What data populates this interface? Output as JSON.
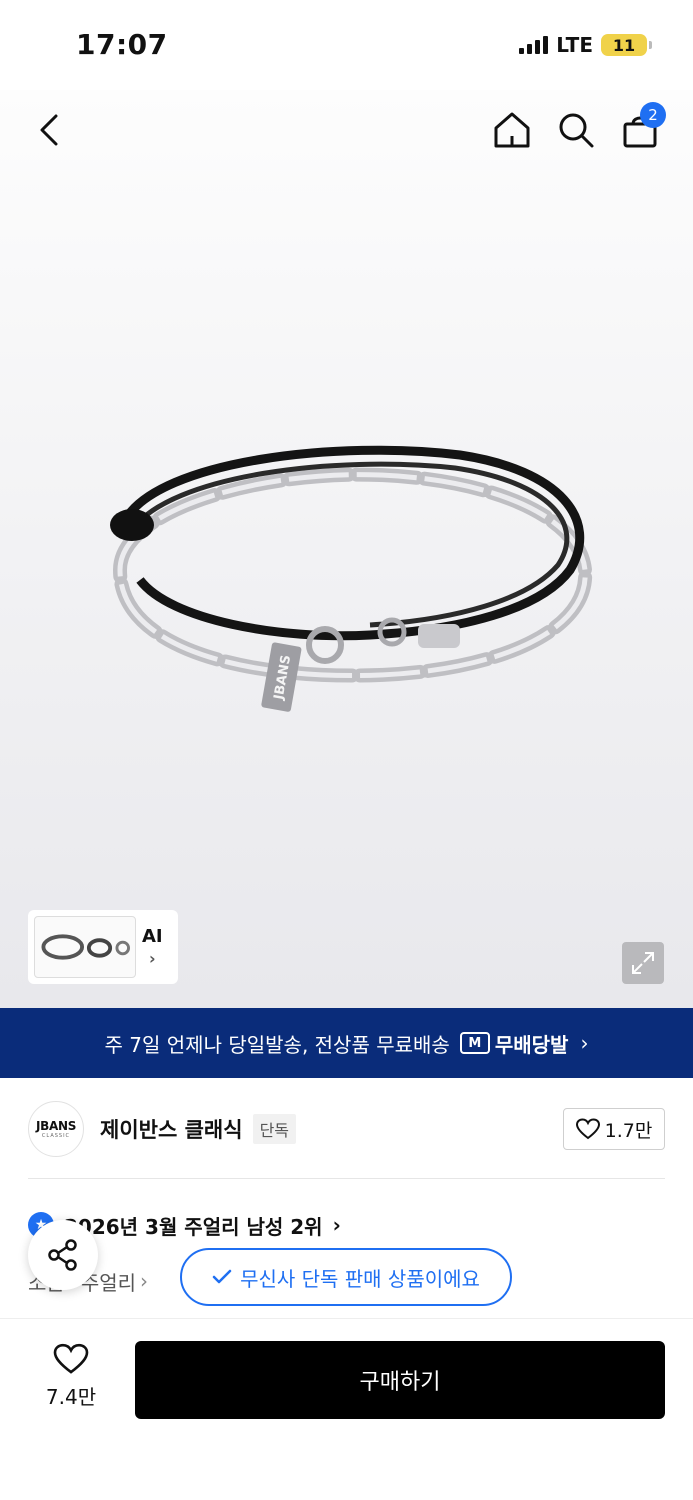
{
  "status_bar": {
    "time": "17:07",
    "network": "LTE",
    "battery": "11"
  },
  "nav": {
    "cart_count": "2"
  },
  "gallery": {
    "ai_label": "AI"
  },
  "product_image": {
    "tag_text": "JBANS"
  },
  "banner": {
    "text": "주 7일 언제나 당일발송, 전상품 무료배송",
    "brand": "무배당발"
  },
  "brand": {
    "logo_text": "JBANS",
    "logo_sub": "CLASSIC",
    "name": "제이반스 클래식",
    "tag": "단독",
    "likes": "1.7만"
  },
  "ranking": {
    "text": "2026년 3월 주얼리 남성 2위"
  },
  "category": {
    "parent": "소품",
    "child": "주얼리"
  },
  "exclusive": {
    "text": "무신사 단독 판매 상품이에요"
  },
  "bottom": {
    "wish_count": "7.4만",
    "buy_label": "구매하기"
  },
  "colors": {
    "accent_blue": "#1f6ff2",
    "banner_navy": "#0a2c7a",
    "battery_yellow": "#f0d24a"
  },
  "icons": [
    "back-icon",
    "home-icon",
    "search-icon",
    "cart-icon",
    "expand-icon",
    "heart-icon",
    "share-icon",
    "check-icon",
    "chevron-right-icon"
  ]
}
